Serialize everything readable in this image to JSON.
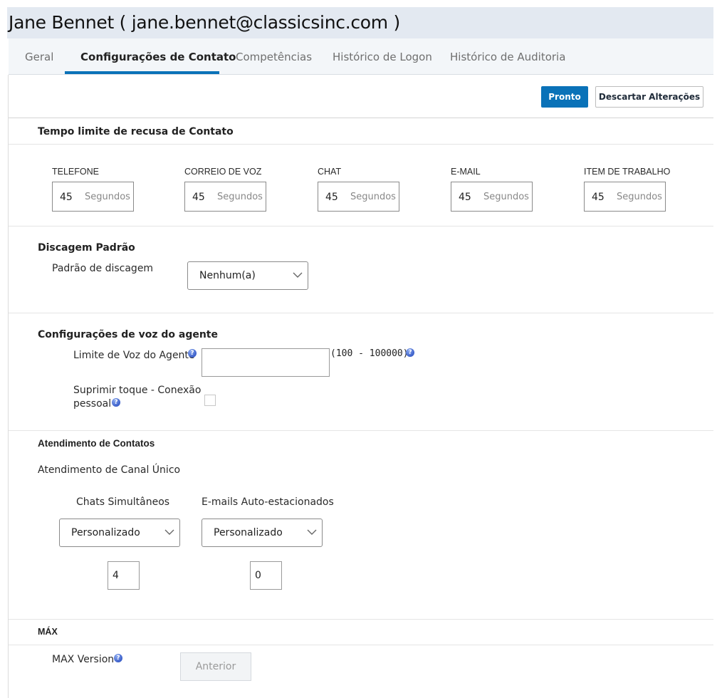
{
  "header": {
    "title": "Jane Bennet ( jane.bennet@classicsinc.com )"
  },
  "tabs": [
    {
      "label": "Geral",
      "active": false
    },
    {
      "label": "Configurações de Contato",
      "active": true
    },
    {
      "label": "Competências",
      "active": false
    },
    {
      "label": "Histórico de Logon",
      "active": false
    },
    {
      "label": "Histórico de Auditoria",
      "active": false
    }
  ],
  "toolbar": {
    "done_label": "Pronto",
    "discard_label": "Descartar Alterações"
  },
  "refusal_timeout": {
    "heading": "Tempo limite de recusa de Contato",
    "channels": [
      {
        "label": "TELEFONE",
        "value": "45",
        "unit": "Segundos"
      },
      {
        "label": "CORREIO DE VOZ",
        "value": "45",
        "unit": "Segundos"
      },
      {
        "label": "CHAT",
        "value": "45",
        "unit": "Segundos"
      },
      {
        "label": "E-MAIL",
        "value": "45",
        "unit": "Segundos"
      },
      {
        "label": "ITEM DE TRABALHO",
        "value": "45",
        "unit": "Segundos"
      }
    ]
  },
  "default_dialing": {
    "heading": "Discagem Padrão",
    "field_label": "Padrão de discagem",
    "selected": "Nenhum(a)"
  },
  "voice_settings": {
    "heading": "Configurações de voz do agente",
    "limit_label": "Limite de Voz do Agente",
    "limit_value": "",
    "limit_range": "(100 - 100000)",
    "suppress_label_line1": "Suprimir toque - Conexão",
    "suppress_label_line2": "pessoal",
    "suppress_checked": false
  },
  "contact_handling": {
    "heading": "Atendimento de Contatos",
    "mode_label": "Atendimento de Canal Único",
    "chats_label": "Chats Simultâneos",
    "chats_selected": "Personalizado",
    "chats_value": "4",
    "emails_label": "E-mails Auto-estacionados",
    "emails_selected": "Personalizado",
    "emails_value": "0"
  },
  "max": {
    "heading": "MÁX",
    "version_label": "MAX Version",
    "previous_label": "Anterior"
  },
  "icons": {
    "help": "help-circle-icon",
    "dropdown": "chevron-down-icon",
    "help_glyph": "?"
  },
  "colors": {
    "accent": "#0a72b8",
    "header_bg": "#e3e9f1",
    "tabbar_bg": "#f3f6f9",
    "help_icon": "#3b5fc9"
  }
}
